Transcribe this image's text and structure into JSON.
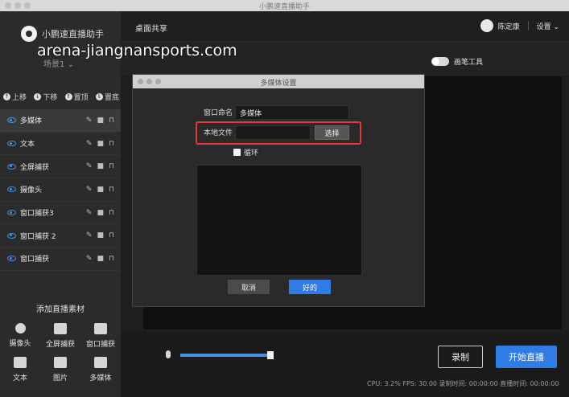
{
  "window": {
    "title": "小鹏速直播助手"
  },
  "watermark": "arena-jiangnansports.com",
  "brand": {
    "name": "小鹏速直播助手"
  },
  "scene": {
    "label": "场景1 ⌄"
  },
  "toolbar": [
    {
      "icon": "up-arrow-icon",
      "label": "上移"
    },
    {
      "icon": "down-arrow-icon",
      "label": "下移"
    },
    {
      "icon": "pin-top-icon",
      "label": "置顶"
    },
    {
      "icon": "pin-bottom-icon",
      "label": "置底"
    }
  ],
  "sources": [
    {
      "label": "多媒体",
      "selected": true
    },
    {
      "label": "文本",
      "selected": false
    },
    {
      "label": "全屏捕获",
      "selected": false
    },
    {
      "label": "摄像头",
      "selected": false
    },
    {
      "label": "窗口捕获3",
      "selected": false
    },
    {
      "label": "窗口捕获 2",
      "selected": false
    },
    {
      "label": "窗口捕获",
      "selected": false
    }
  ],
  "add_materials": {
    "title": "添加直播素材",
    "items": [
      {
        "icon": "camera-icon",
        "label": "摄像头"
      },
      {
        "icon": "monitor-icon",
        "label": "全屏捕获"
      },
      {
        "icon": "window-icon",
        "label": "窗口捕获"
      },
      {
        "icon": "text-icon",
        "label": "文本"
      },
      {
        "icon": "image-icon",
        "label": "图片"
      },
      {
        "icon": "media-icon",
        "label": "多媒体"
      }
    ]
  },
  "topbar": {
    "tab": "桌面共享",
    "user_name": "陈定康",
    "settings_label": "设置 ⌄"
  },
  "pen_tool": {
    "label": "画笔工具"
  },
  "dialog": {
    "title": "多媒体设置",
    "name_label": "窗口命名",
    "name_value": "多媒体",
    "file_label": "本地文件",
    "file_value": "",
    "choose_label": "选择",
    "loop_label": "循环",
    "cancel_label": "取消",
    "ok_label": "好的"
  },
  "bottom": {
    "volume": 0.92,
    "record_label": "录制",
    "live_label": "开始直播",
    "status": "CPU: 3.2%  FPS: 30.00  录制时间: 00:00:00  直播时间: 00:00:00"
  },
  "colors": {
    "accent": "#2f7ce5",
    "highlight": "#e53935",
    "eye": "#4a90e2"
  }
}
